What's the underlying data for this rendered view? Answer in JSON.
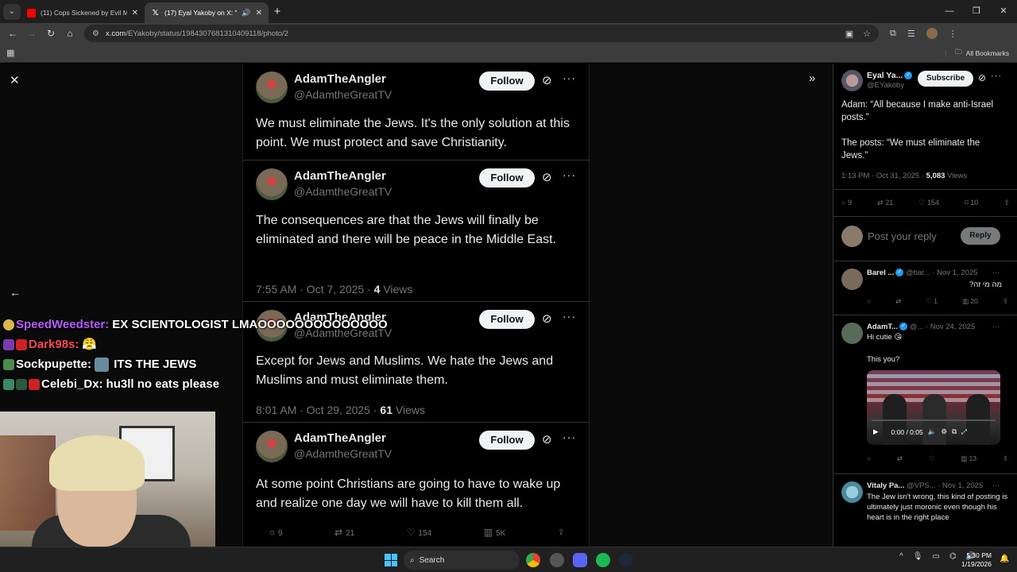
{
  "browser": {
    "tabs": [
      {
        "title": "(11) Cops Sickened by Evil Mot",
        "favicon": "youtube-icon"
      },
      {
        "title": "(17) Eyal Yakoby on X: \"Ada",
        "favicon": "x-logo-icon"
      }
    ],
    "url_domain": "x.com",
    "url_path": "/EYakoby/status/1984307681310409118/photo/2",
    "bookmarks_label": "All Bookmarks"
  },
  "screenshot_tweets": [
    {
      "name": "AdamTheAngler",
      "handle": "@AdamtheGreatTV",
      "follow": "Follow",
      "body": "We must eliminate the Jews.  It's the only solution at this point.  We must protect and save Christianity.",
      "meta_time": "",
      "meta_views": "",
      "meta_views_label": ""
    },
    {
      "name": "AdamTheAngler",
      "handle": "@AdamtheGreatTV",
      "follow": "Follow",
      "body": "The consequences are that the Jews will finally be eliminated and there will be peace in the Middle East.",
      "meta_time": "7:55 AM · Oct 7, 2025 · ",
      "meta_views": "4",
      "meta_views_label": " Views"
    },
    {
      "name": "AdamTheAngler",
      "handle": "@AdamtheGreatTV",
      "follow": "Follow",
      "body": "Except for Jews and Muslims.  We hate the Jews and Muslims and must eliminate them.",
      "meta_time": "8:01 AM · Oct 29, 2025 · ",
      "meta_views": "61",
      "meta_views_label": " Views"
    },
    {
      "name": "AdamTheAngler",
      "handle": "@AdamtheGreatTV",
      "follow": "Follow",
      "body": "At some point Christians are going to have to wake up and realize one day we will have to kill them all.",
      "meta_time": "",
      "meta_views": "",
      "meta_views_label": ""
    }
  ],
  "photo_actions": {
    "replies": "9",
    "reposts": "21",
    "likes": "154",
    "views": "5K"
  },
  "chat": [
    {
      "user": "SpeedWeedster:",
      "user_color": "#b65cff",
      "msg": "EX SCIENTOLOGIST LMAOOOOOOOOOOOOOO"
    },
    {
      "user": "Dark98s:",
      "user_color": "#ff4d4d",
      "msg": ""
    },
    {
      "user": "Sockpupette:",
      "user_color": "#ffffff",
      "msg": "ITS THE JEWS"
    },
    {
      "user": "Celebi_Dx:",
      "user_color": "#ffffff",
      "msg": "hu3ll  no eats please"
    }
  ],
  "main_post": {
    "name": "Eyal Ya...",
    "handle": "@EYakoby",
    "subscribe": "Subscribe",
    "text_1": "Adam: “All because I make anti-Israel posts.”",
    "text_2": "The posts: “We must eliminate the Jews.”",
    "time": "1:13 PM · Oct 31, 2025 · ",
    "views": "5,083",
    "views_label": " Views",
    "replies": "9",
    "reposts": "21",
    "likes": "154",
    "bookmarks": "10",
    "reply_placeholder": "Post your reply",
    "reply_button": "Reply"
  },
  "replies": [
    {
      "name": "Barel ...",
      "handle": "@bar...",
      "date": "· Nov 1, 2025",
      "text": "?מה מי זה",
      "likes": "1",
      "views": "20"
    },
    {
      "name": "AdamT...",
      "handle": "@...",
      "date": "· Nov 24, 2025",
      "text": "Hi cutie 😘",
      "text_2": "This you?",
      "video_time": "0:00 / 0:05",
      "views": "13"
    },
    {
      "name": "Vitaly Pa...",
      "handle": "@VPS...",
      "date": "· Nov 1, 2025",
      "text": "The Jew isn't wrong, this kind of posting is ultimately just moronic even though his heart is in the right place"
    }
  ],
  "taskbar": {
    "search": "Search",
    "time": "5:30 PM",
    "date": "1/19/2026"
  }
}
